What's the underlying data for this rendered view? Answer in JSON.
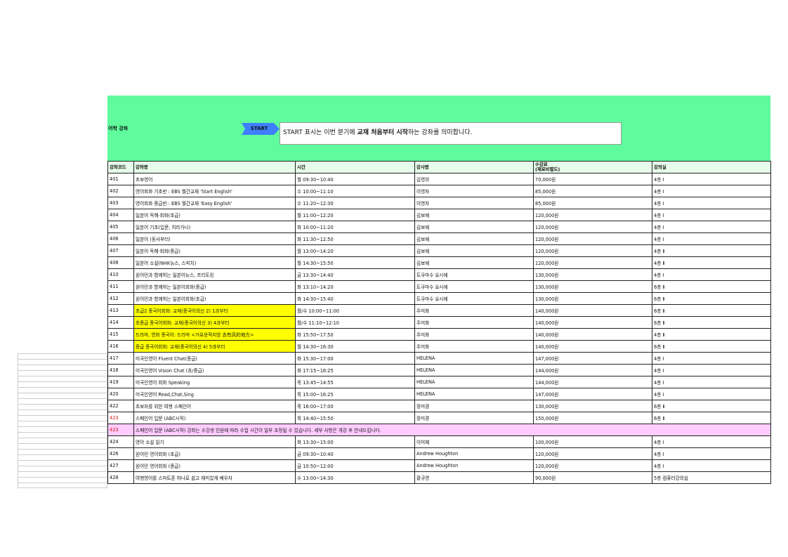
{
  "header": {
    "section_title": "어학 강좌",
    "start_label": "START",
    "note_pre": "START 표시는 이번 분기에 ",
    "note_bold": "교재 처음부터 시작",
    "note_post": "하는 강좌를 의미합니다."
  },
  "columns": [
    "강좌코드",
    "강좌명",
    "시간",
    "강사명",
    "수강료\n(재료비별도)",
    "강의실"
  ],
  "rows": [
    {
      "code": "401",
      "name": "초보영어",
      "time": "월 09:30~10:40",
      "teacher": "김영희",
      "fee": "70,000원",
      "room": "4층 Ⅰ"
    },
    {
      "code": "402",
      "name": "영어회화 기초반 : EBS 월간교재 'Start English'",
      "time": "수 10:00~11:10",
      "teacher": "이영자",
      "fee": "85,000원",
      "room": "4층 Ⅰ"
    },
    {
      "code": "403",
      "name": "영어회화 중급반 : EBS 월간교재 'Easy English'",
      "time": "수 11:20~12:30",
      "teacher": "이영자",
      "fee": "85,000원",
      "room": "4층 Ⅰ"
    },
    {
      "code": "404",
      "name": "일본어 독해·회화(초급)",
      "time": "월 11:00~12:20",
      "teacher": "김보예",
      "fee": "120,000원",
      "room": "4층 Ⅰ"
    },
    {
      "code": "405",
      "name": "일본어 기초(입문, 히라가나)",
      "time": "화 10:00~11:20",
      "teacher": "김보예",
      "fee": "120,000원",
      "room": "4층 Ⅰ"
    },
    {
      "code": "406",
      "name": "일본어 (동사부터)",
      "time": "화 11:30~12:50",
      "teacher": "김보예",
      "fee": "120,000원",
      "room": "4층 Ⅰ"
    },
    {
      "code": "407",
      "name": "일본어 독해·회화(중급)",
      "time": "월 13:00~14:20",
      "teacher": "김보예",
      "fee": "120,000원",
      "room": "4층 Ⅱ"
    },
    {
      "code": "408",
      "name": "일본어 소설(NHK뉴스, 스피치)",
      "time": "월 14:30~15:50",
      "teacher": "김보예",
      "fee": "120,000원",
      "room": "4층 Ⅱ"
    },
    {
      "code": "410",
      "name": "원어민과 함께하는 일본어뉴스, 프리토킹",
      "time": "금 13:30~14:40",
      "teacher": "도쿠마수 요시에",
      "fee": "130,000원",
      "room": "4층 Ⅰ"
    },
    {
      "code": "411",
      "name": "원어민과 함께하는 일본어회화(중급)",
      "time": "화 13:10~14:20",
      "teacher": "도쿠마수 요시에",
      "fee": "130,000원",
      "room": "6층 Ⅱ"
    },
    {
      "code": "412",
      "name": "원어민과 함께하는 일본어회화(초급)",
      "time": "화 14:30~15:40",
      "teacher": "도쿠마수 요시에",
      "fee": "130,000원",
      "room": "6층 Ⅱ"
    },
    {
      "code": "413",
      "name": "초급2 중국어회화: 교재(중국어의신 2) 1과부터",
      "time": "월/수 10:00~11:00",
      "teacher": "주미화",
      "fee": "140,000원",
      "room": " 6층 Ⅱ",
      "hl": true
    },
    {
      "code": "414",
      "name": "초중급 중국어회화: 교재(중국어의신 3) 4과부터",
      "time": "월/수 11:10~12:10",
      "teacher": "주미화",
      "fee": "140,000원",
      "room": "6층 Ⅱ",
      "hl": true
    },
    {
      "code": "415",
      "name": "드라마, 영화 중국어: 드라마 <거유용적지방 去有风的地方>",
      "time": "화 15:50~17:50",
      "teacher": "주미화",
      "fee": "140,000원",
      "room": "4층 Ⅱ",
      "hl": true
    },
    {
      "code": "416",
      "name": "중급 중국어회화: 교재(중국어의신 4) 5과부터",
      "time": "월 14:30~16:30",
      "teacher": "주미화",
      "fee": "140,000원",
      "room": "6층 Ⅱ",
      "hl": true
    },
    {
      "code": "417",
      "name": "미국인영어 Fluent Chat(중급)",
      "time": "화 15:30~17:00",
      "teacher": "HELENA",
      "fee": "147,000원",
      "room": "4층 Ⅰ"
    },
    {
      "code": "418",
      "name": "미국인영어 Vision Chat (초/중급)",
      "time": "화 17:15~18:25",
      "teacher": "HELENA",
      "fee": "144,000원",
      "room": "4층 Ⅰ"
    },
    {
      "code": "419",
      "name": "미국인영어 회화 Speaking",
      "time": "목 13:45~14:55",
      "teacher": "HELENA",
      "fee": "144,000원",
      "room": "4층 Ⅰ"
    },
    {
      "code": "420",
      "name": "미국인영어 Read,Chat,Sing",
      "time": "목 15:00~16:25",
      "teacher": "HELENA",
      "fee": "147,000원",
      "room": "4층 Ⅰ"
    },
    {
      "code": "422",
      "name": "초보자를 위한 여행 스페인어",
      "time": "목 16:00~17:00",
      "teacher": "장미경",
      "fee": "130,000원",
      "room": "6층 Ⅱ"
    },
    {
      "code": "423",
      "name": "스페인어 입문 (ABC시작)",
      "time": "목 14:40~15:50",
      "teacher": "장미경",
      "fee": "150,000원",
      "room": "6층 Ⅱ",
      "red": true
    },
    {
      "code": "423",
      "note": "스페인어 입문 (ABC시작) 강좌는 수강생 인원에 따라 수업 시간이 일부 조정될 수 있습니다. 세부 사항은 개강 후 안내드립니다.",
      "red": true,
      "pink": true
    },
    {
      "code": "424",
      "name": "영어 소설 읽기",
      "time": "화 13:30~15:00",
      "teacher": "이미혜",
      "fee": "100,000원",
      "room": "4층 Ⅰ"
    },
    {
      "code": "426",
      "name": "원어민 영어회화 (초급)",
      "time": "금 09:30~10:40",
      "teacher": "Andrew Houghton",
      "fee": "120,000원",
      "room": "4층 Ⅰ"
    },
    {
      "code": "427",
      "name": "원어민 영어회화 (중급)",
      "time": "금 10:50~12:00",
      "teacher": "Andrew Houghton",
      "fee": "120,000원",
      "room": "4층 Ⅰ"
    },
    {
      "code": "428",
      "name": "여행영어를 스마트폰 하나로 쉽고 재미있게 배우자",
      "time": "수 13:00~14:30",
      "teacher": "황규영",
      "fee": "90,000원",
      "room": "5층 컴퓨터강의실"
    }
  ]
}
